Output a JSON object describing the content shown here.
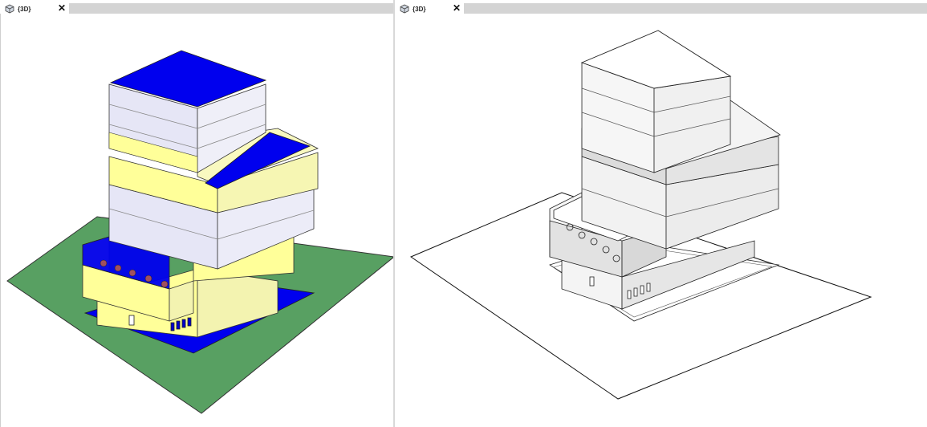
{
  "views": [
    {
      "tab_label": "{3D}",
      "close_glyph": "✕",
      "icon": "cube-icon",
      "style": "shaded"
    },
    {
      "tab_label": "{3D}",
      "close_glyph": "✕",
      "icon": "cube-icon",
      "style": "hidden-line"
    }
  ],
  "colors": {
    "ground": "#58a062",
    "roof_blue": "#0000ee",
    "wall_yellow": "#ffff99",
    "glass": "#e0e0f4",
    "gray_face": "#dcdcdc",
    "tab_strip": "#d4d4d4"
  }
}
